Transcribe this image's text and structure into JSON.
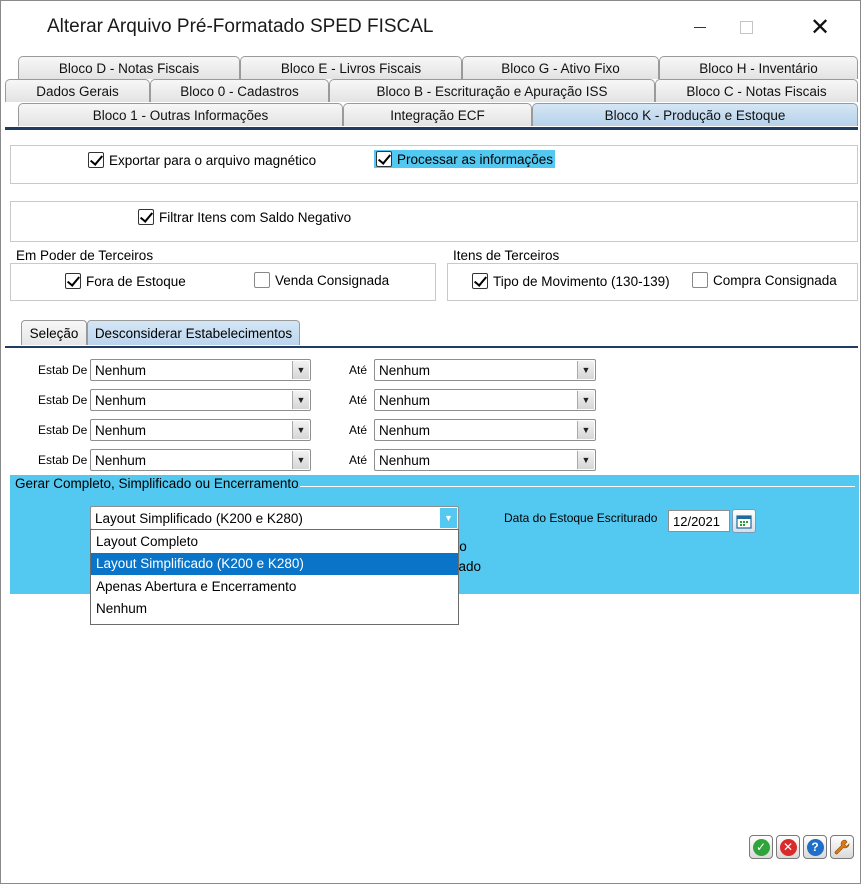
{
  "window": {
    "title": "Alterar Arquivo Pré-Formatado SPED FISCAL",
    "minimize_icon": "minimize-icon",
    "maximize_icon": "maximize-icon",
    "close_icon": "close-icon"
  },
  "tabs": {
    "row1": [
      "Bloco D - Notas Fiscais",
      "Bloco E - Livros Fiscais",
      "Bloco G - Ativo Fixo",
      "Bloco H - Inventário"
    ],
    "row2": [
      "Dados Gerais",
      "Bloco 0 - Cadastros",
      "Bloco B - Escrituração e Apuração ISS",
      "Bloco C - Notas Fiscais"
    ],
    "row3": [
      "Bloco 1 - Outras Informações",
      "Integração ECF",
      "Bloco K - Produção e Estoque"
    ],
    "active": "Bloco K - Produção e Estoque"
  },
  "options": {
    "exportar": {
      "label": "Exportar para o arquivo magnético",
      "checked": true
    },
    "processar": {
      "label": "Processar as informações",
      "checked": true
    },
    "filtrar": {
      "label": "Filtrar Itens com Saldo Negativo",
      "checked": true
    }
  },
  "em_poder": {
    "title": "Em Poder de Terceiros",
    "fora_estoque": {
      "label": "Fora de Estoque",
      "checked": true
    },
    "venda_consignada": {
      "label": "Venda Consignada",
      "checked": false
    }
  },
  "itens_terceiros": {
    "title": "Itens de Terceiros",
    "tipo_movimento": {
      "label": "Tipo de Movimento (130-139)",
      "checked": true
    },
    "compra_consignada": {
      "label": "Compra Consignada",
      "checked": false
    }
  },
  "subtabs": [
    "Seleção",
    "Desconsiderar Estabelecimentos"
  ],
  "estab": {
    "de_label": "Estab De",
    "ate_label": "Até",
    "rows": [
      {
        "de": "Nenhum",
        "ate": "Nenhum"
      },
      {
        "de": "Nenhum",
        "ate": "Nenhum"
      },
      {
        "de": "Nenhum",
        "ate": "Nenhum"
      },
      {
        "de": "Nenhum",
        "ate": "Nenhum"
      }
    ]
  },
  "gerar": {
    "title": "Gerar Completo, Simplificado ou Encerramento",
    "selected": "Layout Simplificado (K200 e K280)",
    "options": [
      "Layout Completo",
      "Layout Simplificado (K200 e K280)",
      "Apenas Abertura e Encerramento",
      "Nenhum"
    ],
    "hidden_text_1": "rto",
    "hidden_text_2": "nado",
    "data_label": "Data do Estoque Escriturado",
    "data_value": "12/2021"
  },
  "buttons": {
    "ok_icon": "check-icon",
    "cancel_icon": "cancel-icon",
    "help_icon": "help-icon",
    "tools_icon": "wrench-icon"
  },
  "colors": {
    "highlight": "#53c8f0",
    "selected_option": "#0a74c9",
    "tab_line": "#1f3c63"
  }
}
